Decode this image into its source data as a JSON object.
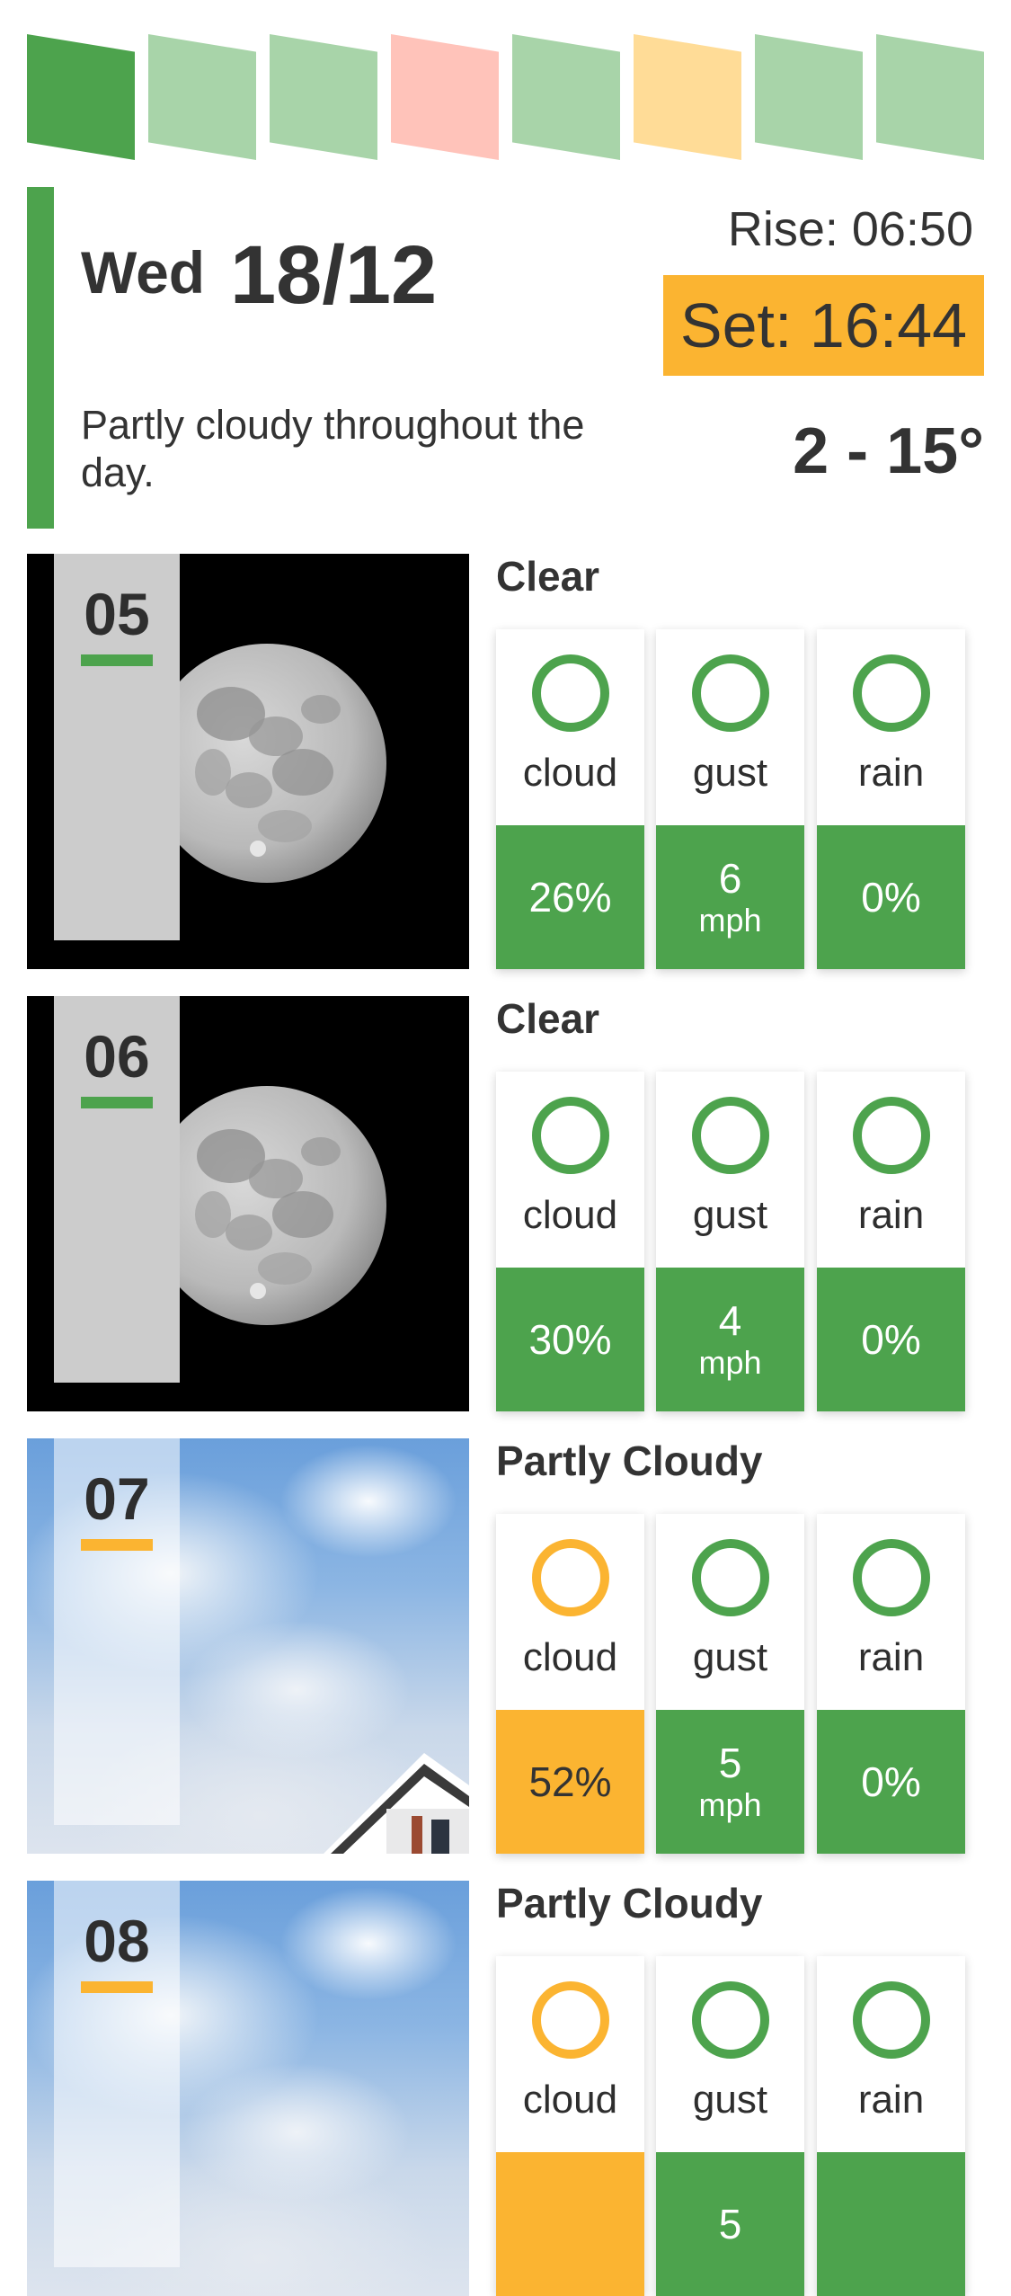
{
  "colors": {
    "good": "#4da34d",
    "good_light": "#a8d4a9",
    "warn": "#fbb431",
    "warn_light": "#ffdc97",
    "bad_light": "#ffc3ba",
    "label_dark": "#2e2e2e"
  },
  "day_strip": [
    {
      "status": "good",
      "selected": true,
      "color": "#4da34d"
    },
    {
      "status": "good",
      "selected": false,
      "color": "#a8d4a9"
    },
    {
      "status": "good",
      "selected": false,
      "color": "#a8d4a9"
    },
    {
      "status": "bad",
      "selected": false,
      "color": "#ffc3ba"
    },
    {
      "status": "good",
      "selected": false,
      "color": "#a8d4a9"
    },
    {
      "status": "warn",
      "selected": false,
      "color": "#ffdc97"
    },
    {
      "status": "good",
      "selected": false,
      "color": "#a8d4a9"
    },
    {
      "status": "good",
      "selected": false,
      "color": "#a8d4a9"
    }
  ],
  "summary": {
    "day": "Wed",
    "date": "18/12",
    "description": "Partly cloudy throughout the day.",
    "sunrise": "Rise: 06:50",
    "sunset": "Set: 16:44",
    "temp_range": "2 - 15°"
  },
  "hours": [
    {
      "hour": "05",
      "condition": "Clear",
      "image": "moon-night",
      "accent": "#4da34d",
      "metrics": {
        "cloud": {
          "label": "cloud",
          "value": "26%",
          "unit": "",
          "color": "#4da34d"
        },
        "gust": {
          "label": "gust",
          "value": "6",
          "unit": "mph",
          "color": "#4da34d"
        },
        "rain": {
          "label": "rain",
          "value": "0%",
          "unit": "",
          "color": "#4da34d"
        }
      }
    },
    {
      "hour": "06",
      "condition": "Clear",
      "image": "moon-night",
      "accent": "#4da34d",
      "metrics": {
        "cloud": {
          "label": "cloud",
          "value": "30%",
          "unit": "",
          "color": "#4da34d"
        },
        "gust": {
          "label": "gust",
          "value": "4",
          "unit": "mph",
          "color": "#4da34d"
        },
        "rain": {
          "label": "rain",
          "value": "0%",
          "unit": "",
          "color": "#4da34d"
        }
      }
    },
    {
      "hour": "07",
      "condition": "Partly Cloudy",
      "image": "cloudy-sky",
      "accent": "#fbb431",
      "metrics": {
        "cloud": {
          "label": "cloud",
          "value": "52%",
          "unit": "",
          "color": "#fbb431"
        },
        "gust": {
          "label": "gust",
          "value": "5",
          "unit": "mph",
          "color": "#4da34d"
        },
        "rain": {
          "label": "rain",
          "value": "0%",
          "unit": "",
          "color": "#4da34d"
        }
      }
    },
    {
      "hour": "08",
      "condition": "Partly Cloudy",
      "image": "cloudy-sky",
      "accent": "#fbb431",
      "metrics": {
        "cloud": {
          "label": "cloud",
          "value": "",
          "unit": "",
          "color": "#fbb431"
        },
        "gust": {
          "label": "gust",
          "value": "5",
          "unit": "",
          "color": "#4da34d"
        },
        "rain": {
          "label": "rain",
          "value": "",
          "unit": "",
          "color": "#4da34d"
        }
      }
    }
  ]
}
